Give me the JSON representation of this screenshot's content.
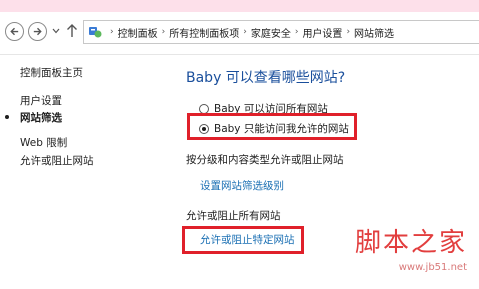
{
  "breadcrumb": {
    "items": [
      "控制面板",
      "所有控制面板项",
      "家庭安全",
      "用户设置",
      "网站筛选"
    ]
  },
  "sidebar": {
    "home": "控制面板主页",
    "items": [
      {
        "label": "用户设置",
        "selected": false
      },
      {
        "label": "网站筛选",
        "selected": true
      },
      {
        "label": "Web 限制",
        "selected": false
      },
      {
        "label": "允许或阻止网站",
        "selected": false
      }
    ]
  },
  "main": {
    "title": "Baby 可以查看哪些网站?",
    "options": [
      {
        "label": "Baby 可以访问所有网站",
        "checked": false
      },
      {
        "label": "Baby 只能访问我允许的网站",
        "checked": true
      }
    ],
    "section1_heading": "按分级和内容类型允许或阻止网站",
    "section1_link": "设置网站筛选级别",
    "section2_heading": "允许或阻止所有网站",
    "section2_link": "允许或阻止特定网站"
  },
  "watermark": {
    "title": "脚本之家",
    "url": "www.jb51.net"
  },
  "colors": {
    "title": "#1a4f9c",
    "link": "#1a6fb3",
    "highlight": "#e0202a",
    "watermark": "#e23e3e"
  }
}
